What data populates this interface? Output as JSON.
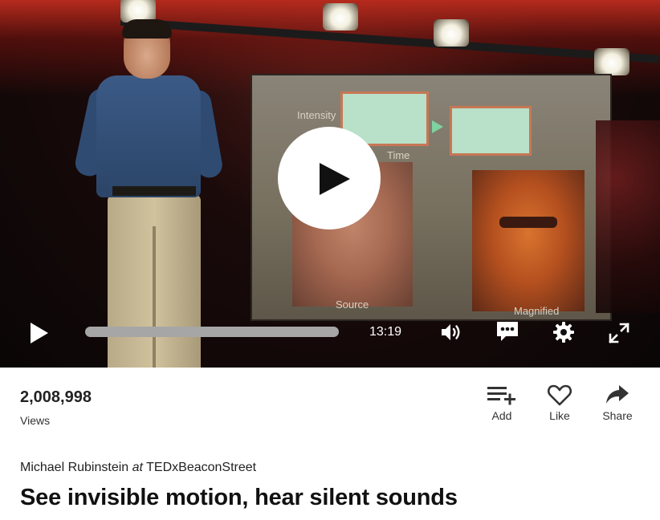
{
  "video": {
    "duration": "13:19",
    "icons": {
      "play_overlay": "play-icon",
      "play": "play-icon",
      "volume": "volume-icon",
      "subtitles": "speech-bubble-icon",
      "settings": "gear-icon",
      "fullscreen": "fullscreen-icon"
    },
    "slide": {
      "intensity": "Intensity",
      "time": "Time",
      "source": "Source",
      "magnified": "Magnified"
    }
  },
  "stats": {
    "count": "2,008,998",
    "label": "Views"
  },
  "actions": [
    {
      "label": "Add",
      "icon": "add-to-list-icon"
    },
    {
      "label": "Like",
      "icon": "heart-icon"
    },
    {
      "label": "Share",
      "icon": "share-arrow-icon"
    }
  ],
  "byline": {
    "speaker": "Michael Rubinstein",
    "at": "at",
    "event": "TEDxBeaconStreet"
  },
  "talk": {
    "title": "See invisible motion, hear silent sounds"
  }
}
